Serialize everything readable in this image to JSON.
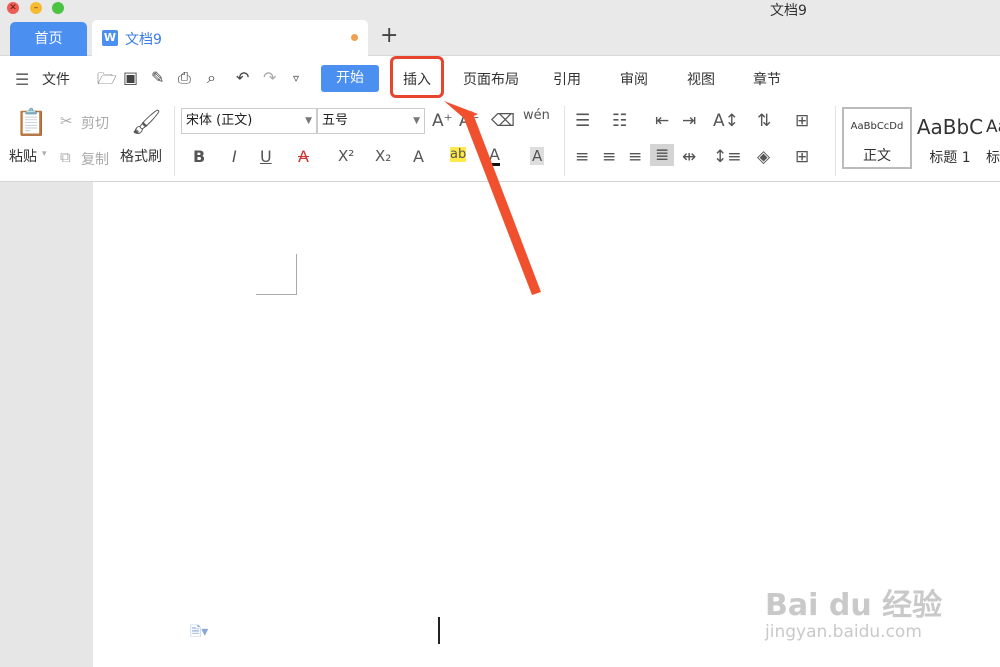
{
  "window": {
    "title": "文档9"
  },
  "tabs": {
    "home": "首页",
    "document": "文档9",
    "add": "+"
  },
  "menubar": {
    "file": "文件",
    "items": [
      "开始",
      "插入",
      "页面布局",
      "引用",
      "审阅",
      "视图",
      "章节"
    ]
  },
  "ribbon": {
    "paste": "粘贴",
    "cut": "剪切",
    "copy": "复制",
    "format_painter": "格式刷",
    "font_name": "宋体 (正文)",
    "font_size": "五号",
    "styles": [
      {
        "sample": "AaBbCcDd",
        "name": "正文"
      },
      {
        "sample": "AaBbC",
        "name": "标题 1"
      },
      {
        "sample": "Aa",
        "name": "标"
      }
    ]
  },
  "watermark": {
    "brand": "Bai du 经验",
    "url": "jingyan.baidu.com"
  },
  "colors": {
    "accent": "#4b8ff0",
    "highlight_box": "#e8442e",
    "arrow": "#f0502e"
  }
}
